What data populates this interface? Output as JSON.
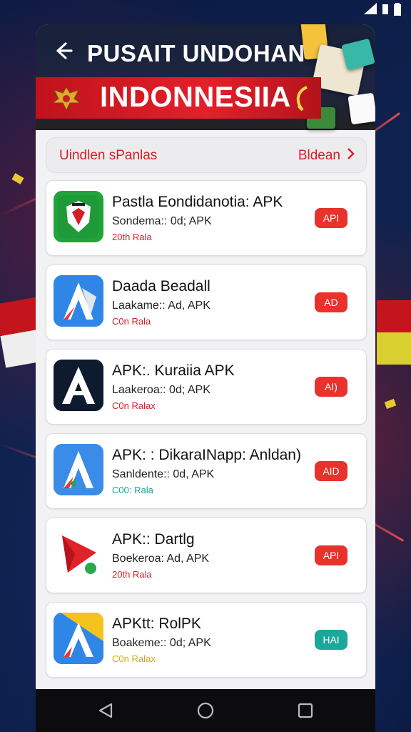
{
  "header": {
    "title": "PUSAIT UNDOHAN",
    "banner_title": "INDONNESIIA"
  },
  "filter": {
    "left_label": "Uindlen sPanlas",
    "right_label": "Bldean"
  },
  "apps": [
    {
      "name": "Pastla Eondidanotia: APK",
      "sub": "Sondema:: 0d; APK",
      "size": "20th Rala",
      "action": "API",
      "size_color": "#d61f26"
    },
    {
      "name": "Daada Beadall",
      "sub": "Laakame:: Ad, APK",
      "size": "C0n Rala",
      "action": "AD",
      "size_color": "#d61f26"
    },
    {
      "name": "APK:. Kuraiia APK",
      "sub": "Laakeroa:: 0d; APK",
      "size": "C0n Ralax",
      "action": "AI)",
      "size_color": "#d61f26"
    },
    {
      "name": "APK: : DikaraINapp: Anldan)",
      "sub": "Sanldente:: 0d, APK",
      "size": "C00: Rala",
      "action": "AID",
      "size_color": "#1aa39a"
    },
    {
      "name": "APK:: Dartlg",
      "sub": "Boekeroa: Ad, APK",
      "size": "20th Rala",
      "action": "API",
      "size_color": "#d61f26"
    },
    {
      "name": "APKtt: RolPK",
      "sub": "Boakeme:: 0d; APK",
      "size": "C0n Ralax",
      "action": "HAI",
      "size_color": "#c9b400"
    }
  ]
}
